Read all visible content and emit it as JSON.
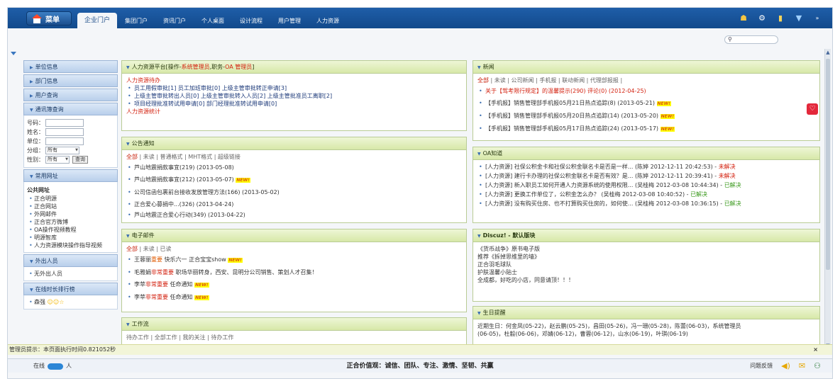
{
  "topbar": {
    "menu_label": "菜单",
    "tabs": [
      "企业门户",
      "集团门户",
      "资讯门户",
      "个人桌面",
      "设计流程",
      "用户管理",
      "人力资源"
    ],
    "icons": [
      "users-icon",
      "gear-icon",
      "clipboard-icon",
      "message-icon",
      "expand-icon"
    ]
  },
  "search": {
    "placeholder": ""
  },
  "sidebar": {
    "unit_info": "单位信息",
    "dept_info": "部门信息",
    "user_query": "用户查询",
    "directory_query": "通讯簿查询",
    "form": {
      "no_label": "号码：",
      "name_label": "姓名：",
      "unit_label": "单位：",
      "group_label": "分组：",
      "group_value": "所有",
      "gender_label": "性别：",
      "gender_value": "所有",
      "query_btn": "查询"
    },
    "common_sites": "常用网址",
    "public_sites_title": "公共网址",
    "sites": [
      "正合明源",
      "正合网站",
      "外网邮件",
      "正合官方微博",
      "OA操作视频教程",
      "明源智库",
      "人力资源模块操作指导视频"
    ],
    "outgoing": "外出人员",
    "outgoing_none": "无外出人员",
    "online_rank": "在线时长排行榜",
    "online_first": "森强"
  },
  "panels": {
    "hr": {
      "title_prefix": "人力资源平台[操作-",
      "title_role1": "系统管理员",
      "title_mid": ",职务-",
      "title_role2": "OA 管理员",
      "title_suffix": "]",
      "todo_title": "人力资源待办",
      "items": [
        "员工用假审批[1] 员工加班审批[0] 上级主管审批转正申请[3]",
        "上级主管审批转出人员[0] 上级主管审批转入人员[2] 上级主管批准员工离职[2]",
        "项目经理批准转试用申请[0] 部门经理批准转试用申请[0]"
      ],
      "stats": "人力资源统计"
    },
    "notice": {
      "title": "公告通知",
      "filters_first": "全部",
      "filters_rest": " | 未读 | 普通格式 | MHT格式 | 超级链接",
      "items": [
        "芦山地震捐款事宜(219) (2013-05-08)",
        "芦山地震捐款事宜(212) (2013-05-07)",
        "公司信函包裹前台接收发放管理方法(166) (2013-05-02)",
        "正合爱心募捐中...(326) (2013-04-24)",
        "芦山地震正合爱心行动(349) (2013-04-22)"
      ]
    },
    "email": {
      "title": "电子邮件",
      "filters_first": "全部",
      "filters_rest": " | 未读 | 已读",
      "items": [
        {
          "pre": "王蓉丽",
          "mark": "重要",
          "post": " 快乐六一 正合宝宝show"
        },
        {
          "pre": "毛雅娟",
          "mark": "非常重要",
          "post": " 职场华丽转身，西安、昆明分公司销售、策划人才召集！"
        },
        {
          "pre": "李苹",
          "mark": "非常重要",
          "post": " 任命通知"
        },
        {
          "pre": "李苹",
          "mark": "非常重要",
          "post": " 任命通知"
        }
      ],
      "new_badge": "NEW!"
    },
    "workflow": {
      "title": "工作流",
      "filters": "待办工作 | 全部工作 | 我的关注 | 待办工作"
    },
    "news": {
      "title": "新闻",
      "filters_first": "全部",
      "filters_rest": " | 未读 | 公司新闻 | 手机报 | 联动新闻 | 代理部报报 |",
      "items": [
        {
          "text": "关于【驾考限行规定】的温馨提示(290) 评论(0) (2012-04-25)",
          "red": true,
          "new": false
        },
        {
          "text": "【手机报】销售管理部手机报05月21日热点追踪(8) (2013-05-21)",
          "red": false,
          "new": true
        },
        {
          "text": "【手机报】销售管理部手机报05月20日热点追踪(14) (2013-05-20)",
          "red": false,
          "new": true
        },
        {
          "text": "【手机报】销售管理部手机报05月17日热点追踪(24) (2013-05-17)",
          "red": false,
          "new": true
        }
      ]
    },
    "oa": {
      "title": "OA知道",
      "items": [
        {
          "text": "[人力资源] 社保公积金卡和社保公积金联名卡是否是一样... (陈婷 2012-12-11 20:42:53) - ",
          "status": "未解决",
          "solved": false
        },
        {
          "text": "[人力资源] 建行卡办理的社保公积金联名卡是否有效？是... (陈婷 2012-12-11 20:39:41) - ",
          "status": "未解决",
          "solved": false
        },
        {
          "text": "[人力资源] 新入职员工如何开通人力资源系统的使用权限... (吴桂梅 2012-03-08 10:44:34) - ",
          "status": "已解决",
          "solved": true
        },
        {
          "text": "[人力资源] 更换工作单位了，公积金怎么办？ (吴桂梅 2012-03-08 10:40:52) - ",
          "status": "已解决",
          "solved": true
        },
        {
          "text": "[人力资源] 没有购买住房、也不打算购买住房的，如何使... (吴桂梅 2012-03-08 10:36:15) - ",
          "status": "已解决",
          "solved": true
        }
      ]
    },
    "discuz": {
      "title": "Discuz! - 默认版块",
      "lines": [
        "《货币战争》原书电子版",
        "推荐《拆掉思维里的墙》",
        "正合羽毛球队",
        "护肤温馨小贴士",
        "全成都，好吃的小店，同意请顶！！！"
      ]
    },
    "birthday": {
      "title": "生日提醒",
      "label": "近期生日：",
      "line1": "何金凤(05-22)，赵云鹏(05-25)，昌田(05-26)，冯一珊(05-28)，陈蕾(06-03)，系统管理员",
      "line2": "(06-05)，杜毅(06-06)，邓婧(06-12)，曹蓉(06-12)，山水(06-19)，叶琪(06-19)"
    }
  },
  "status": {
    "text": "管理员提示：本页面执行时间0.821052秒",
    "close": "×"
  },
  "bottom": {
    "online_label": "在线",
    "online_unit": "人",
    "values": "正合价值观：诚信、团队、专注、激情、坚韧、共赢",
    "feedback": "问题反馈"
  }
}
